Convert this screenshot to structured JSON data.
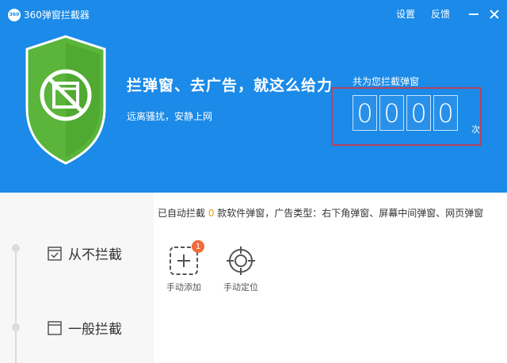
{
  "app": {
    "title": "360弹窗拦截器",
    "logo_text": "360"
  },
  "window": {
    "settings": "设置",
    "feedback": "反馈",
    "minimize_icon": "minimize-icon",
    "close_icon": "close-icon"
  },
  "hero": {
    "headline": "拦弹窗、去广告，就这么给力",
    "subline": "远离骚扰，安静上网",
    "shield_icon": "shield-block-icon",
    "colors": {
      "header": "#1b8ae8",
      "shield": "#5ab53a",
      "highlight": "#b7435f"
    }
  },
  "counter": {
    "label": "共为您拦截弹窗",
    "digits": [
      "0",
      "0",
      "0",
      "0"
    ],
    "unit": "次"
  },
  "info": {
    "prefix": "已自动拦截 ",
    "count": "0",
    "suffix": " 款软件弹窗，广告类型：右下角弹窗、屏幕中间弹窗、网页弹窗",
    "count_color": "#f39c12"
  },
  "sidebar": {
    "items": [
      {
        "label": "从不拦截",
        "icon": "checked-window-icon"
      },
      {
        "label": "一般拦截",
        "icon": "window-icon"
      }
    ]
  },
  "tools": [
    {
      "label": "手动添加",
      "icon": "add-dashed-icon",
      "badge": "1"
    },
    {
      "label": "手动定位",
      "icon": "crosshair-icon"
    }
  ]
}
